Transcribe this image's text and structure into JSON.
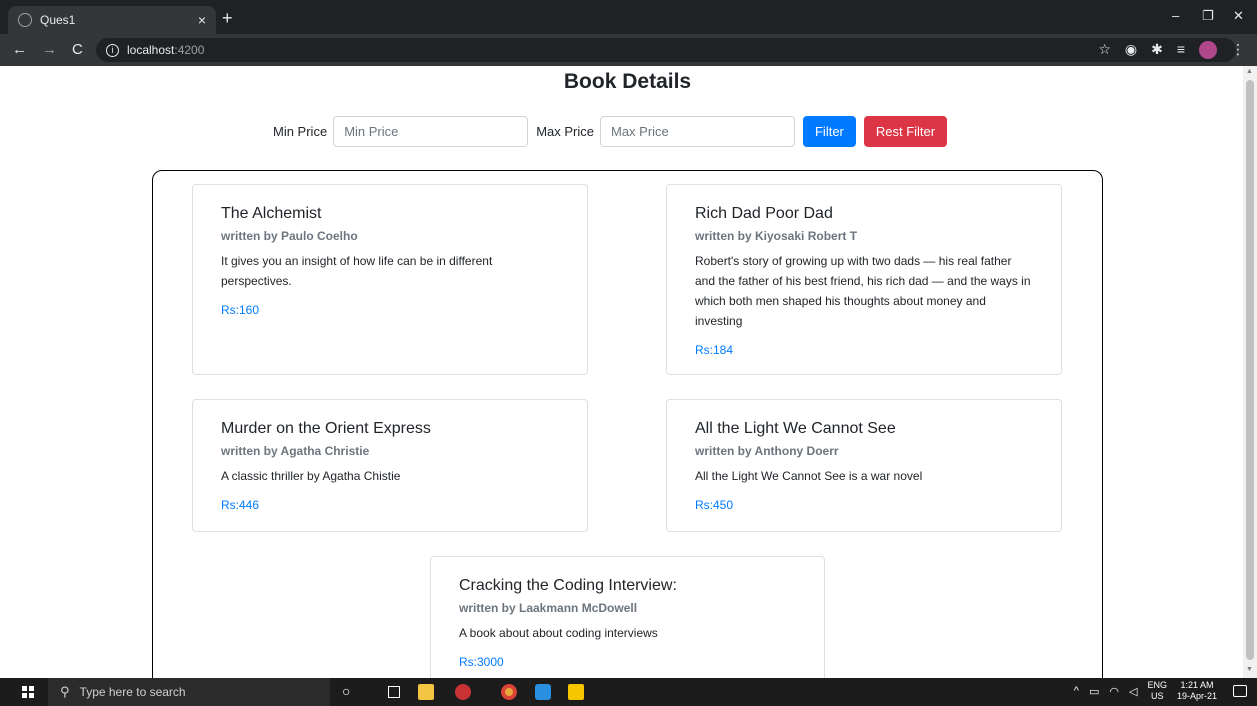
{
  "browser": {
    "tab_title": "Ques1",
    "tab_close": "×",
    "new_tab": "+",
    "url_host": "localhost",
    "url_port": ":4200",
    "win_min": "–",
    "win_max": "❐",
    "win_close": "✕"
  },
  "page": {
    "title": "Book Details"
  },
  "filter": {
    "min_label": "Min Price",
    "min_placeholder": "Min Price",
    "max_label": "Max Price",
    "max_placeholder": "Max Price",
    "filter_button": "Filter",
    "reset_button": "Rest Filter"
  },
  "books": [
    {
      "title": "The Alchemist",
      "author": "written by Paulo Coelho",
      "description": "It gives you an insight of how life can be in different perspectives.",
      "price": "Rs:160"
    },
    {
      "title": "Rich Dad Poor Dad",
      "author": "written by Kiyosaki Robert T",
      "description": "Robert's story of growing up with two dads — his real father and the father of his best friend, his rich dad — and the ways in which both men shaped his thoughts about money and investing",
      "price": "Rs:184"
    },
    {
      "title": "Murder on the Orient Express",
      "author": "written by Agatha Christie",
      "description": "A classic thriller by Agatha Chistie",
      "price": "Rs:446"
    },
    {
      "title": "All the Light We Cannot See",
      "author": "written by Anthony Doerr",
      "description": "All the Light We Cannot See is a war novel",
      "price": "Rs:450"
    },
    {
      "title": "Cracking the Coding Interview:",
      "author": "written by Laakmann McDowell",
      "description": "A book about about coding interviews",
      "price": "Rs:3000"
    }
  ],
  "taskbar": {
    "search_placeholder": "Type here to search",
    "lang_top": "ENG",
    "lang_bottom": "US",
    "time": "1:21 AM",
    "date": "19-Apr-21"
  },
  "colors": {
    "primary": "#007bff",
    "danger": "#dc3545"
  }
}
